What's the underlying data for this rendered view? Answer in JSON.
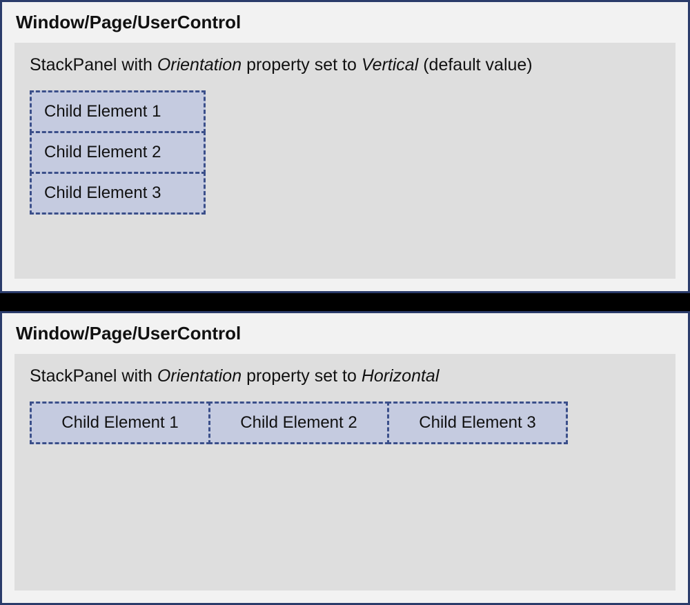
{
  "top": {
    "window_title": "Window/Page/UserControl",
    "stackpanel": {
      "desc_prefix": "StackPanel with ",
      "desc_prop": "Orientation",
      "desc_mid": " property set to ",
      "desc_value": "Vertical",
      "desc_suffix": " (default value)",
      "orientation": "vertical",
      "children": [
        {
          "label": "Child Element 1"
        },
        {
          "label": "Child Element 2"
        },
        {
          "label": "Child Element 3"
        }
      ]
    }
  },
  "bottom": {
    "window_title": "Window/Page/UserControl",
    "stackpanel": {
      "desc_prefix": "StackPanel with ",
      "desc_prop": "Orientation",
      "desc_mid": " property set to ",
      "desc_value": "Horizontal",
      "desc_suffix": "",
      "orientation": "horizontal",
      "children": [
        {
          "label": "Child Element 1"
        },
        {
          "label": "Child Element 2"
        },
        {
          "label": "Child Element 3"
        }
      ]
    }
  },
  "colors": {
    "window_border": "#2a3b6a",
    "window_bg": "#f2f2f2",
    "panel_bg": "#dedede",
    "child_bg": "#c5cbe0",
    "child_border": "#3b4f8a",
    "divider": "#000000"
  }
}
